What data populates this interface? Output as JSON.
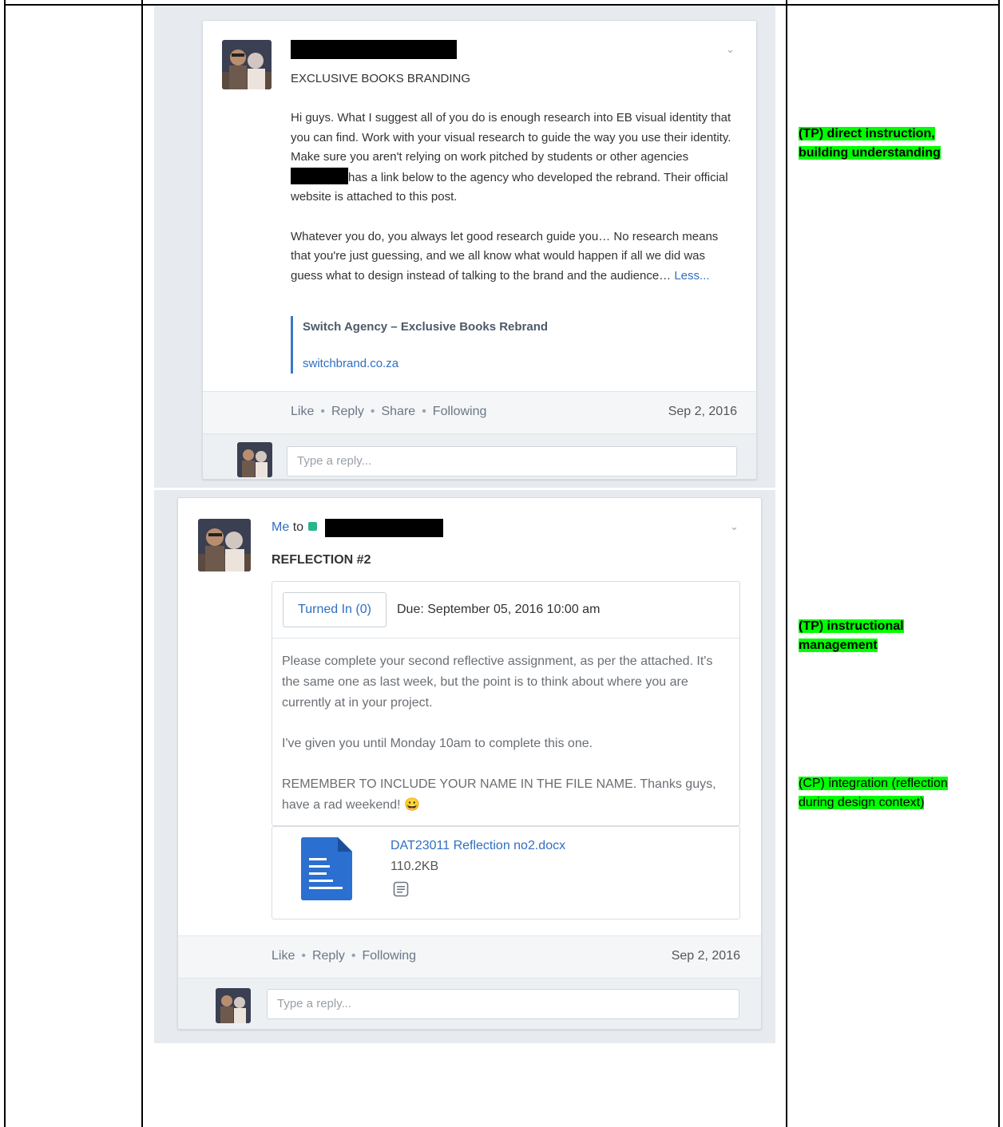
{
  "post1": {
    "title": "EXCLUSIVE BOOKS BRANDING",
    "para1_a": "Hi guys. What I suggest all of you do is enough research into EB visual identity that you can find. Work with your visual research to guide the way you use their identity. Make sure you aren't relying on work pitched by students or other agencies",
    "para1_b": "has a link below to the agency who developed the rebrand. Their official website is attached to this post.",
    "para2": "Whatever you do, you always let good research guide you… No research means that you're just guessing, and we all know what would happen if all we did was guess what to design instead of talking to the brand and the audience…",
    "less": "Less...",
    "link_title": "Switch Agency – Exclusive Books Rebrand",
    "link_url": "switchbrand.co.za",
    "actions": [
      "Like",
      "Reply",
      "Share",
      "Following"
    ],
    "date": "Sep 2, 2016",
    "reply_placeholder": "Type a reply..."
  },
  "post2": {
    "sender": "Me",
    "to": "to",
    "title": "REFLECTION #2",
    "turned_in": "Turned In (0)",
    "due": "Due: September 05, 2016 10:00 am",
    "para1": "Please complete your second reflective assignment, as per the attached. It's the same one as last week, but the point is to think about where you are currently at in your project.",
    "para2": "I've given you until Monday 10am to complete this one.",
    "para3": "REMEMBER TO INCLUDE YOUR NAME IN THE FILE NAME. Thanks guys, have a rad weekend!",
    "emoji": "😀",
    "file_name": "DAT23011 Reflection no2.docx",
    "file_size": "110.2KB",
    "actions": [
      "Like",
      "Reply",
      "Following"
    ],
    "date": "Sep 2, 2016",
    "reply_placeholder": "Type a reply..."
  },
  "annotations": {
    "a1_line1": "(TP) direct instruction,",
    "a1_line2": "building understanding",
    "a2_line1": "(TP) instructional",
    "a2_line2": "management",
    "a3_line1": "(CP) integration (reflection",
    "a3_line2": "during design context)"
  },
  "colors": {
    "link": "#2f6fc1",
    "highlight": "#00ff00",
    "group": "#2bb58f"
  }
}
